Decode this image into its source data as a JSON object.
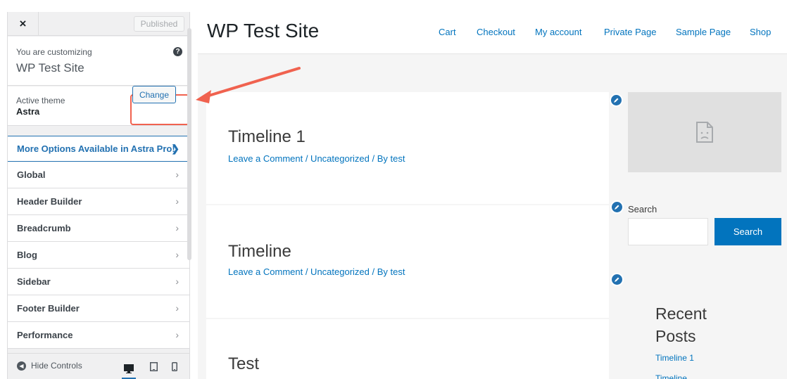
{
  "customizer": {
    "close_symbol": "×",
    "published_label": "Published",
    "customizing_label": "You are customizing",
    "site_name": "WP Test Site",
    "help_symbol": "?",
    "active_theme_label": "Active theme",
    "theme_name": "Astra",
    "change_label": "Change",
    "pro_label": "More Options Available in Astra Pro!",
    "pro_chevron": "❯",
    "menu_chevron": "›",
    "menu": [
      {
        "label": "Global"
      },
      {
        "label": "Header Builder"
      },
      {
        "label": "Breadcrumb"
      },
      {
        "label": "Blog"
      },
      {
        "label": "Sidebar"
      },
      {
        "label": "Footer Builder"
      },
      {
        "label": "Performance"
      }
    ],
    "hide_controls_label": "Hide Controls",
    "devices": [
      "desktop",
      "tablet",
      "mobile"
    ]
  },
  "preview": {
    "site_title": "WP Test Site",
    "nav": [
      "Cart",
      "Checkout",
      "My account",
      "Private Page",
      "Sample Page",
      "Shop"
    ],
    "posts": [
      {
        "title": "Timeline 1",
        "meta": "Leave a Comment / Uncategorized / By test"
      },
      {
        "title": "Timeline",
        "meta": "Leave a Comment / Uncategorized / By test"
      },
      {
        "title": "Test",
        "meta": ""
      }
    ],
    "search_label": "Search",
    "search_button": "Search",
    "recent_title": "Recent Posts",
    "recent_posts": [
      "Timeline 1",
      "Timeline"
    ]
  },
  "colors": {
    "accent": "#2271b1",
    "link": "#0274be",
    "annotation": "#f0624f"
  }
}
